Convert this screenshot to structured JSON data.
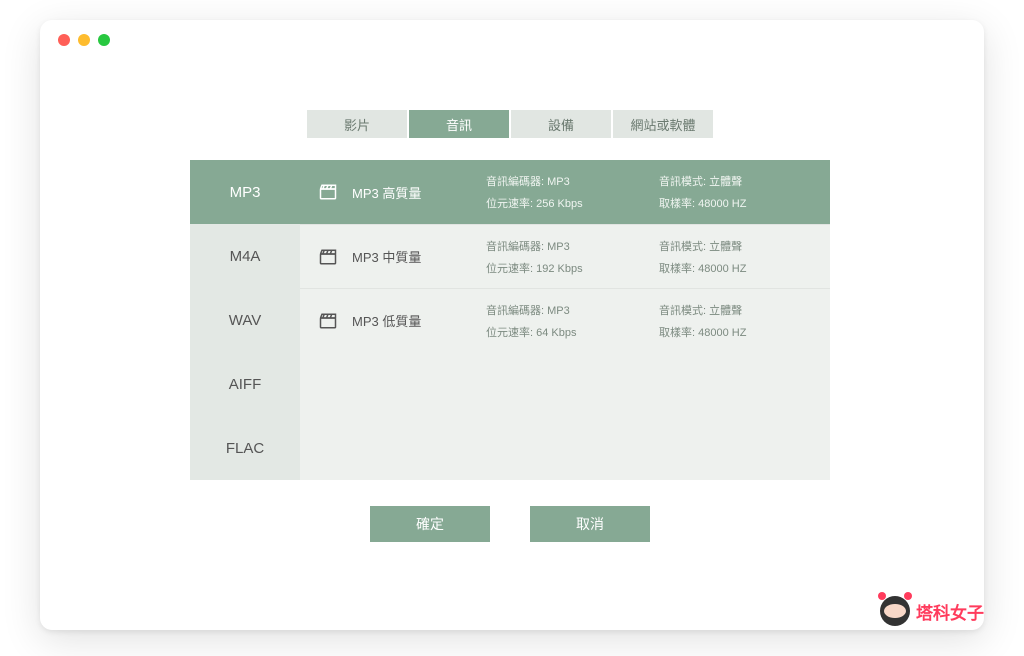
{
  "tabs": [
    {
      "label": "影片",
      "active": false
    },
    {
      "label": "音訊",
      "active": true
    },
    {
      "label": "設備",
      "active": false
    },
    {
      "label": "網站或軟體",
      "active": false
    }
  ],
  "formats": [
    {
      "label": "MP3",
      "active": true
    },
    {
      "label": "M4A",
      "active": false
    },
    {
      "label": "WAV",
      "active": false
    },
    {
      "label": "AIFF",
      "active": false
    },
    {
      "label": "FLAC",
      "active": false
    }
  ],
  "qualities": [
    {
      "name": "MP3 高質量",
      "active": true,
      "codec": "音訊編碼器: MP3",
      "mode": "音訊模式: 立體聲",
      "bitrate": "位元速率: 256 Kbps",
      "samplerate": "取樣率: 48000 HZ"
    },
    {
      "name": "MP3 中質量",
      "active": false,
      "codec": "音訊編碼器: MP3",
      "mode": "音訊模式: 立體聲",
      "bitrate": "位元速率: 192 Kbps",
      "samplerate": "取樣率: 48000 HZ"
    },
    {
      "name": "MP3 低質量",
      "active": false,
      "codec": "音訊編碼器: MP3",
      "mode": "音訊模式: 立體聲",
      "bitrate": "位元速率: 64 Kbps",
      "samplerate": "取樣率: 48000 HZ"
    }
  ],
  "buttons": {
    "confirm": "確定",
    "cancel": "取消"
  },
  "watermark": "塔科女子"
}
